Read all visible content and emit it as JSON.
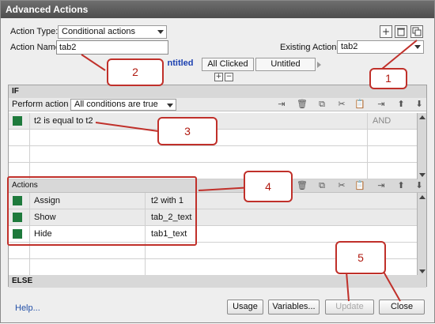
{
  "window": {
    "title": "Advanced Actions"
  },
  "action_type": {
    "label": "Action Type:",
    "value": "Conditional actions"
  },
  "action_name": {
    "label": "Action Name:",
    "value": "tab2"
  },
  "existing": {
    "label": "Existing Actions:",
    "value": "tab2"
  },
  "toolbar_icons": [
    "add-icon",
    "delete-icon",
    "duplicate-icon"
  ],
  "tabs": [
    {
      "label": "ntitled"
    },
    {
      "label": "All Clicked"
    },
    {
      "label": "Untitled"
    }
  ],
  "if_section": {
    "header": "IF",
    "perform_label": "Perform action if:",
    "perform_value": "All conditions are true",
    "conditions": [
      {
        "text": "t2   is equal to    t2",
        "op": "AND"
      }
    ]
  },
  "actions_section": {
    "header": "Actions",
    "rows": [
      {
        "action": "Assign",
        "target": "t2   with   1"
      },
      {
        "action": "Show",
        "target": "tab_2_text"
      },
      {
        "action": "Hide",
        "target": "tab1_text"
      }
    ]
  },
  "else_section": {
    "header": "ELSE"
  },
  "footer": {
    "help": "Help...",
    "usage": "Usage",
    "variables": "Variables...",
    "update": "Update",
    "close": "Close"
  },
  "callouts": [
    "1",
    "2",
    "3",
    "4",
    "5"
  ],
  "colors": {
    "accent_red": "#c0302a",
    "status_green": "#1e7a3c"
  }
}
